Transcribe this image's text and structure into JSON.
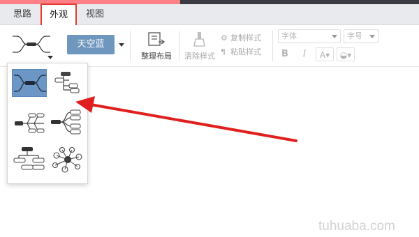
{
  "tabs": [
    "思路",
    "外观",
    "视图"
  ],
  "active_tab": "外观",
  "toolbar": {
    "theme_label": "天空蓝",
    "arrange_label": "整理布局",
    "clear_style_label": "清除样式",
    "copy_style_label": "复制样式",
    "paste_style_label": "粘贴样式",
    "font_placeholder": "字体",
    "size_placeholder": "字号",
    "bold_label": "B",
    "italic_label": "I",
    "font_color_label": "A",
    "accent_color": "#6f96bd"
  },
  "layout_popup": {
    "options": [
      "mind-map",
      "org-chart",
      "fishbone",
      "right-tree",
      "tree-table",
      "bubble"
    ],
    "selected": "mind-map"
  },
  "annotation": {
    "highlight_color": "#e53935"
  },
  "watermark": "tuhuaba.com"
}
